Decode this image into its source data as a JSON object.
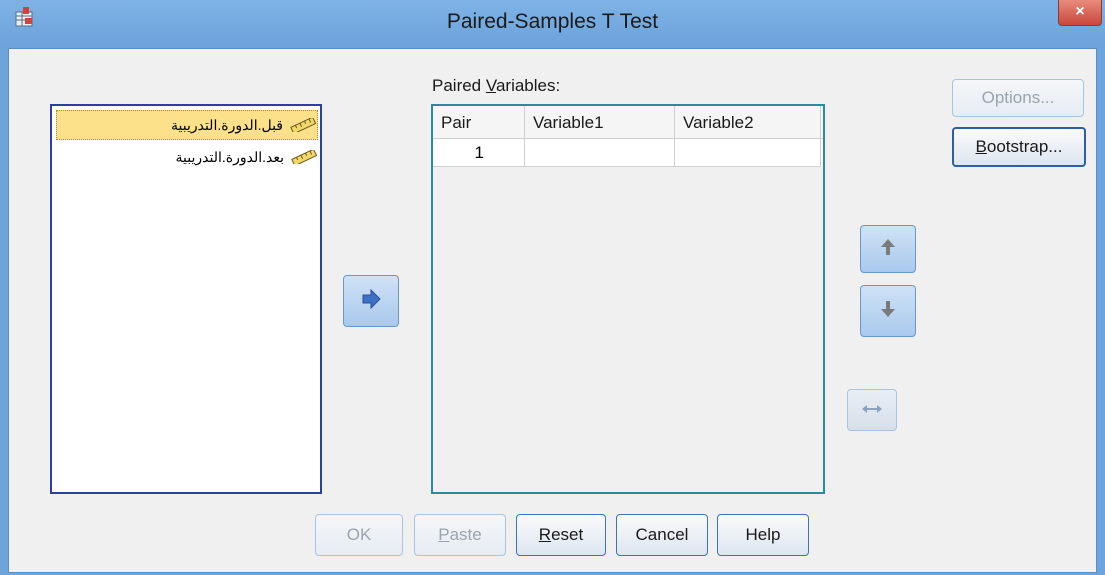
{
  "window": {
    "title": "Paired-Samples T Test",
    "close_label": "×"
  },
  "source_list": {
    "items": [
      {
        "label": "قبل.الدورة.التدريبية",
        "selected": true
      },
      {
        "label": "بعد.الدورة.التدريبية",
        "selected": false
      }
    ]
  },
  "paired_variables": {
    "label_prefix": "Paired ",
    "label_underlined": "V",
    "label_suffix": "ariables:",
    "columns": [
      "Pair",
      "Variable1",
      "Variable2"
    ],
    "rows": [
      {
        "pair": "1",
        "variable1": "",
        "variable2": ""
      }
    ]
  },
  "side_buttons": {
    "options_label": "Options...",
    "bootstrap_underlined": "B",
    "bootstrap_rest": "ootstrap..."
  },
  "bottom_buttons": {
    "ok_label": "OK",
    "paste_underlined": "P",
    "paste_rest": "aste",
    "reset_underlined": "R",
    "reset_rest": "eset",
    "cancel_label": "Cancel",
    "help_label": "Help"
  },
  "icons": {
    "app": "spss-dialog-icon",
    "transfer": "move-right-arrow-icon",
    "up": "move-up-arrow-icon",
    "down": "move-down-arrow-icon",
    "swap": "swap-horizontal-icon",
    "scale_variable": "scale-ruler-icon"
  },
  "colors": {
    "title_bar": "#6ea4dc",
    "selection": "#fce08a",
    "close_button": "#c9473a",
    "list_border": "#2a3f9e"
  }
}
